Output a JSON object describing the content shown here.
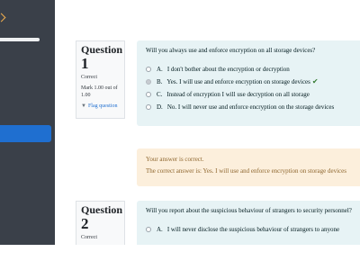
{
  "questions": [
    {
      "title": "Question",
      "number": "1",
      "state": "Correct",
      "mark": "Mark 1.00 out of 1.00",
      "flag_label": "Flag question",
      "text": "Will you always use and enforce encryption on all storage devices?",
      "options": [
        {
          "letter": "A.",
          "text": "I don't bother about the encryption or decryption",
          "selected": false
        },
        {
          "letter": "B.",
          "text": "Yes. I will use and enforce encryption on storage devices",
          "selected": true
        },
        {
          "letter": "C.",
          "text": "Instead of encryption I will use decryption on all storage",
          "selected": false
        },
        {
          "letter": "D.",
          "text": "No. I will never use and enforce encryption on the storage devices",
          "selected": false
        }
      ],
      "feedback": {
        "your_answer": "Your answer is correct.",
        "correct_answer": "The correct answer is: Yes. I will use and enforce encryption on storage devices"
      }
    },
    {
      "title": "Question",
      "number": "2",
      "state": "Correct",
      "text": "Will you report about the suspicious behaviour of strangers to security personnel?",
      "options": [
        {
          "letter": "A.",
          "text": "I will never disclose the suspicious behaviour of strangers to anyone",
          "selected": false
        }
      ]
    }
  ],
  "colors": {
    "sidebar": "#3a4049",
    "accent": "#1f6fd0",
    "question_bg": "#e7f3f5",
    "feedback_bg": "#fcefdc",
    "correct_tick": "#357a32"
  }
}
